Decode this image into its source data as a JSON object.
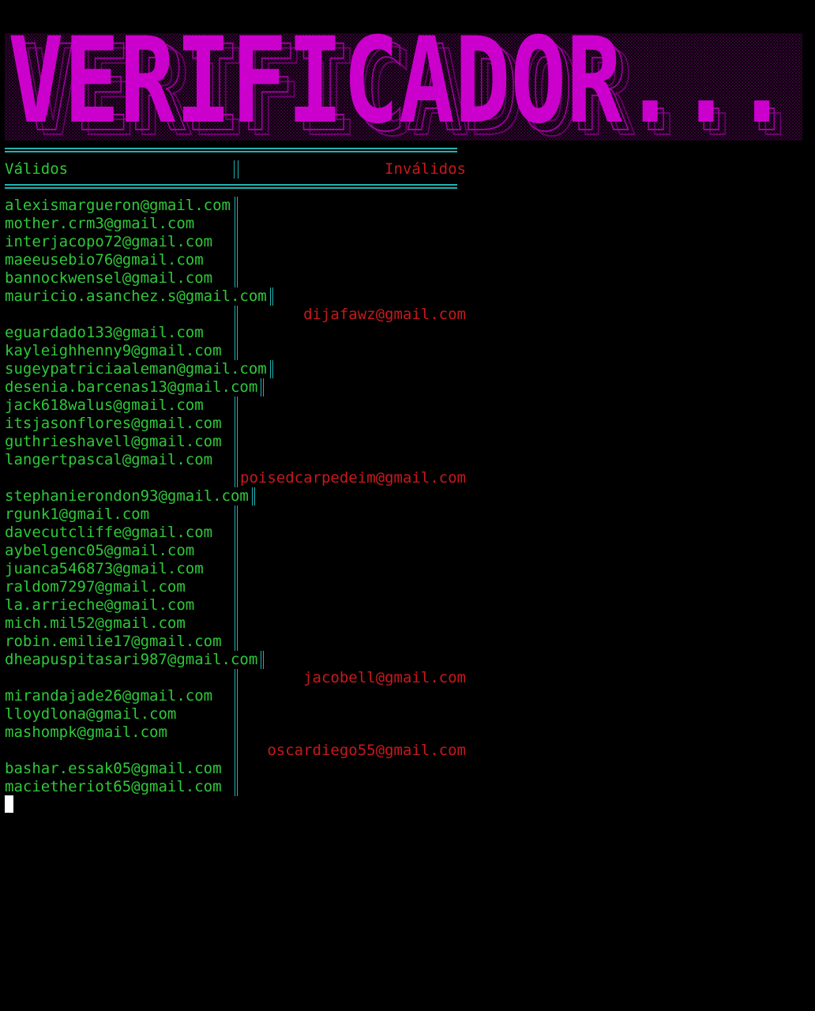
{
  "banner": {
    "title": "VERIFICADOR..."
  },
  "header": {
    "valid_label": "Válidos",
    "invalid_label": "Inválidos"
  },
  "rows": [
    {
      "valid": "alexismargueron@gmail.com",
      "invalid": ""
    },
    {
      "valid": "mother.crm3@gmail.com",
      "invalid": ""
    },
    {
      "valid": "interjacopo72@gmail.com",
      "invalid": ""
    },
    {
      "valid": "maeeusebio76@gmail.com",
      "invalid": ""
    },
    {
      "valid": "bannockwensel@gmail.com",
      "invalid": ""
    },
    {
      "valid": "mauricio.asanchez.s@gmail.com",
      "invalid": ""
    },
    {
      "valid": "",
      "invalid": "dijafawz@gmail.com"
    },
    {
      "valid": "eguardado133@gmail.com",
      "invalid": ""
    },
    {
      "valid": "kayleighhenny9@gmail.com",
      "invalid": ""
    },
    {
      "valid": "sugeypatriciaaleman@gmail.com",
      "invalid": ""
    },
    {
      "valid": "desenia.barcenas13@gmail.com",
      "invalid": ""
    },
    {
      "valid": "jack618walus@gmail.com",
      "invalid": ""
    },
    {
      "valid": "itsjasonflores@gmail.com",
      "invalid": ""
    },
    {
      "valid": "guthrieshavell@gmail.com",
      "invalid": ""
    },
    {
      "valid": "langertpascal@gmail.com",
      "invalid": ""
    },
    {
      "valid": "",
      "invalid": "poisedcarpedeim@gmail.com"
    },
    {
      "valid": "stephanierondon93@gmail.com",
      "invalid": ""
    },
    {
      "valid": "rgunk1@gmail.com",
      "invalid": ""
    },
    {
      "valid": "davecutcliffe@gmail.com",
      "invalid": ""
    },
    {
      "valid": "aybelgenc05@gmail.com",
      "invalid": ""
    },
    {
      "valid": "juanca546873@gmail.com",
      "invalid": ""
    },
    {
      "valid": "raldom7297@gmail.com",
      "invalid": ""
    },
    {
      "valid": "la.arrieche@gmail.com",
      "invalid": ""
    },
    {
      "valid": "mich.mil52@gmail.com",
      "invalid": ""
    },
    {
      "valid": "robin.emilie17@gmail.com",
      "invalid": ""
    },
    {
      "valid": "dheapuspitasari987@gmail.com",
      "invalid": ""
    },
    {
      "valid": "",
      "invalid": "jacobell@gmail.com"
    },
    {
      "valid": "mirandajade26@gmail.com",
      "invalid": ""
    },
    {
      "valid": "lloydlona@gmail.com",
      "invalid": ""
    },
    {
      "valid": "mashompk@gmail.com",
      "invalid": ""
    },
    {
      "valid": "",
      "invalid": "oscardiego55@gmail.com"
    },
    {
      "valid": "bashar.essak05@gmail.com",
      "invalid": ""
    },
    {
      "valid": "macietheriot65@gmail.com",
      "invalid": ""
    }
  ],
  "colors": {
    "background": "#000000",
    "valid_text": "#2fc83a",
    "invalid_text": "#c8181c",
    "separator": "#1fb3b3",
    "banner_text": "#cc00cc"
  }
}
